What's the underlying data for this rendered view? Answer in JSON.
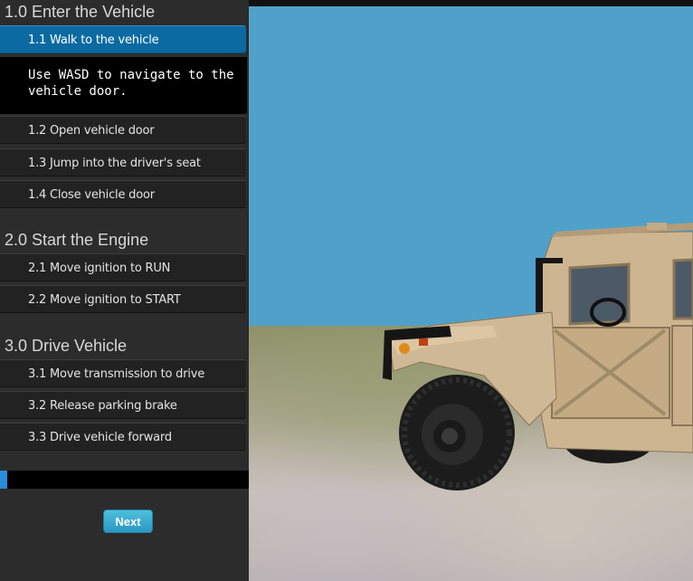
{
  "sections": [
    {
      "title": "1.0 Enter the Vehicle",
      "steps": [
        {
          "label": "1.1 Walk to the vehicle"
        },
        {
          "label": "1.2 Open vehicle door"
        },
        {
          "label": "1.3 Jump into the driver's seat"
        },
        {
          "label": "1.4 Close vehicle door"
        }
      ]
    },
    {
      "title": "2.0 Start the Engine",
      "steps": [
        {
          "label": "2.1 Move ignition to RUN"
        },
        {
          "label": "2.2 Move ignition to START"
        }
      ]
    },
    {
      "title": "3.0 Drive Vehicle",
      "steps": [
        {
          "label": "3.1 Move transmission to drive"
        },
        {
          "label": "3.2 Release parking brake"
        },
        {
          "label": "3.3 Drive vehicle forward"
        }
      ]
    }
  ],
  "active_step_description": "Use WASD to navigate to the vehicle door.",
  "progress_fraction": 0.03,
  "next_button_label": "Next",
  "colors": {
    "active_step": "#0a6aa1",
    "progress": "#2a8bd8",
    "sky": "#4fa1c9",
    "vehicle": "#cdb591"
  }
}
